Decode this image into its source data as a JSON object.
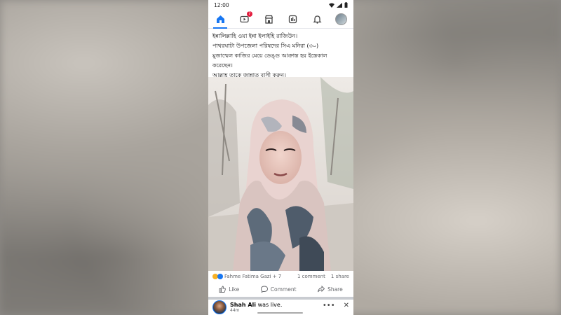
{
  "status": {
    "time": "12:00"
  },
  "nav": {
    "notifications_badge": "7"
  },
  "post": {
    "lines": [
      "ইন্নালিল্লাহি ওয়া ইন্না ইলাইহি রাজিউন।",
      "পাথরঘাটা উপজেলা পরিষদের সিএ মনিরা (৩০)",
      "মুজাম্মেল কাজির মেয়ে ডেঙ্গু আক্রান্ত হয় ইন্তেকাল",
      "করেছেন।",
      "আল্লাহ তাকে জান্নাত বাসী করুন।"
    ]
  },
  "reactions": {
    "names": "Fahme Fatima Gazi + 7",
    "comments": "1 comment",
    "shares": "1 share"
  },
  "actions": {
    "like": "Like",
    "comment": "Comment",
    "share": "Share"
  },
  "live": {
    "name": "Shah Ali",
    "suffix": "was live.",
    "time": "44m"
  }
}
